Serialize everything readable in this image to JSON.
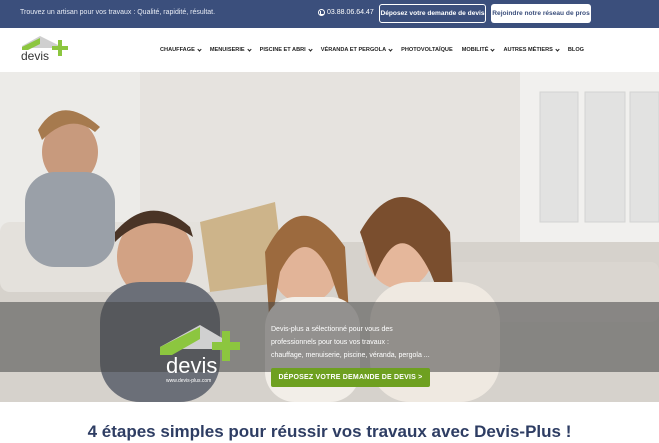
{
  "topbar": {
    "tagline": "Trouvez un artisan pour vos travaux : Qualité, rapidité, résultat.",
    "phone": "03.88.06.64.47",
    "phone_icon": "phone-icon",
    "deposit_button": "Déposez votre demande de devis",
    "join_button": "Rejoindre notre réseau de pros"
  },
  "nav": {
    "logo_text": "devis",
    "items": [
      {
        "label": "CHAUFFAGE",
        "has_dropdown": true
      },
      {
        "label": "MENUISERIE",
        "has_dropdown": true
      },
      {
        "label": "PISCINE ET ABRI",
        "has_dropdown": true
      },
      {
        "label": "VÉRANDA ET PERGOLA",
        "has_dropdown": true
      },
      {
        "label": "PHOTOVOLTAÏQUE",
        "has_dropdown": false
      },
      {
        "label": "MOBILITÉ",
        "has_dropdown": true
      },
      {
        "label": "AUTRES MÉTIERS",
        "has_dropdown": true
      },
      {
        "label": "BLOG",
        "has_dropdown": false
      }
    ]
  },
  "hero": {
    "logo_text": "devis",
    "logo_url": "www.devis-plus.com",
    "line1": "Devis-plus a sélectionné pour vous des",
    "line2": "professionnels pour tous vos travaux :",
    "line3": "chauffage, menuiserie, piscine, véranda, pergola ...",
    "cta": "DÉPOSEZ VOTRE DEMANDE DE DEVIS >"
  },
  "section": {
    "title": "4 étapes simples pour réussir vos travaux avec Devis-Plus !"
  },
  "colors": {
    "topbar": "#3b4f7c",
    "brand_green": "#8cc63f",
    "cta_green": "#6ea020",
    "title_navy": "#2e3d63"
  }
}
